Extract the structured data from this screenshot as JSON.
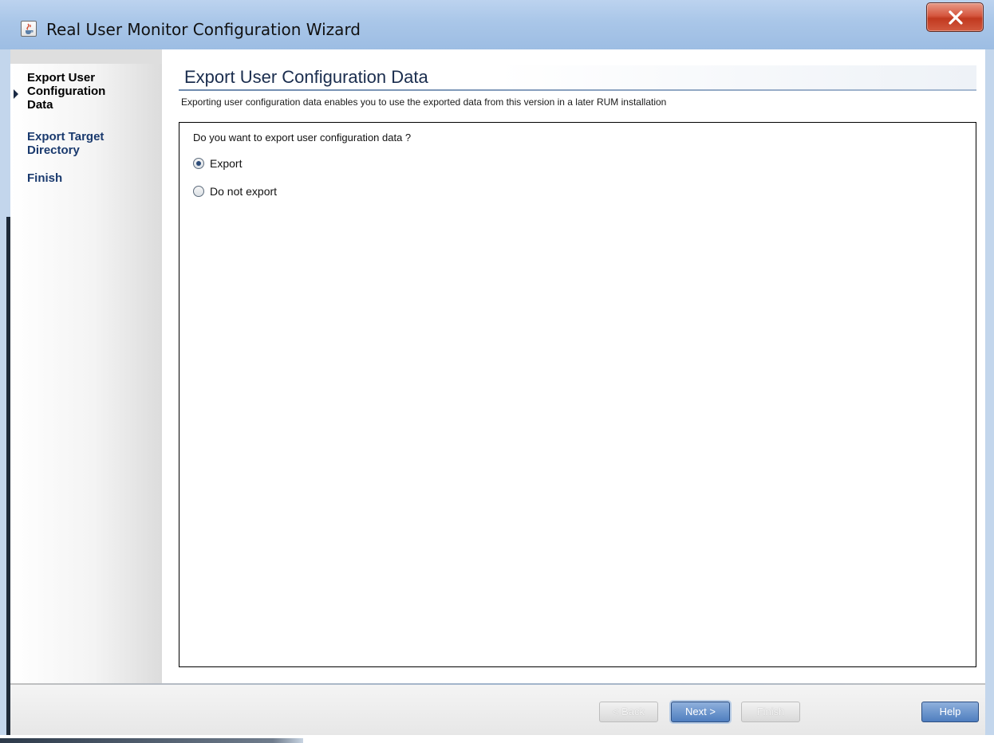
{
  "window": {
    "title": "Real User Monitor Configuration Wizard",
    "app_icon": "java-cup-icon",
    "close_icon": "close-x-icon"
  },
  "nav": {
    "steps": [
      {
        "lines": [
          "Export User",
          "Configuration",
          "Data"
        ],
        "active": true
      },
      {
        "lines": [
          "Export Target",
          "Directory"
        ],
        "active": false
      },
      {
        "lines": [
          "Finish"
        ],
        "active": false
      }
    ]
  },
  "page": {
    "title": "Export User Configuration Data",
    "subtitle": "Exporting user configuration data enables you to use the exported data from this version in a later RUM installation",
    "question": "Do you want to export user configuration data ?",
    "options": [
      {
        "label": "Export",
        "selected": true
      },
      {
        "label": "Do not export",
        "selected": false
      }
    ]
  },
  "buttons": {
    "back": "< Back",
    "next": "Next >",
    "finish": "Finish",
    "help": "Help"
  },
  "colors": {
    "title_bar": "#a9c6e8",
    "close_button": "#c1391f",
    "primary_button": "#4f7ebf",
    "page_title": "#1a2d4e"
  }
}
